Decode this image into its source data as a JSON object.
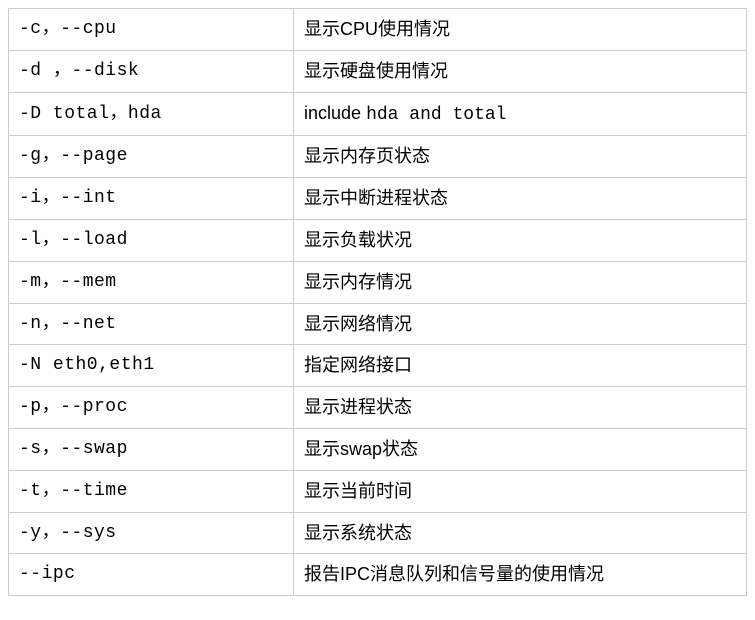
{
  "rows": [
    {
      "option": " -c，--cpu",
      "desc": "显示CPU使用情况"
    },
    {
      "option": "-d ，--disk",
      "desc": "显示硬盘使用情况"
    },
    {
      "option": "-D total，hda",
      "desc_html": "include hda  and total"
    },
    {
      "option": "-g，--page",
      "desc": "显示内存页状态"
    },
    {
      "option": "-i，--int",
      "desc": "显示中断进程状态"
    },
    {
      "option": "-l，--load",
      "desc": "显示负载状况"
    },
    {
      "option": "-m，--mem",
      "desc": "显示内存情况"
    },
    {
      "option": "-n，--net",
      "desc": "显示网络情况"
    },
    {
      "option": "-N eth0,eth1",
      "desc": "指定网络接口"
    },
    {
      "option": "-p，--proc",
      "desc": "显示进程状态"
    },
    {
      "option": "-s，--swap",
      "desc": "显示swap状态"
    },
    {
      "option": "-t，--time",
      "desc": "显示当前时间"
    },
    {
      "option": "-y，--sys",
      "desc": "显示系统状态"
    },
    {
      "option": "--ipc",
      "desc": "报告IPC消息队列和信号量的使用情况"
    }
  ]
}
